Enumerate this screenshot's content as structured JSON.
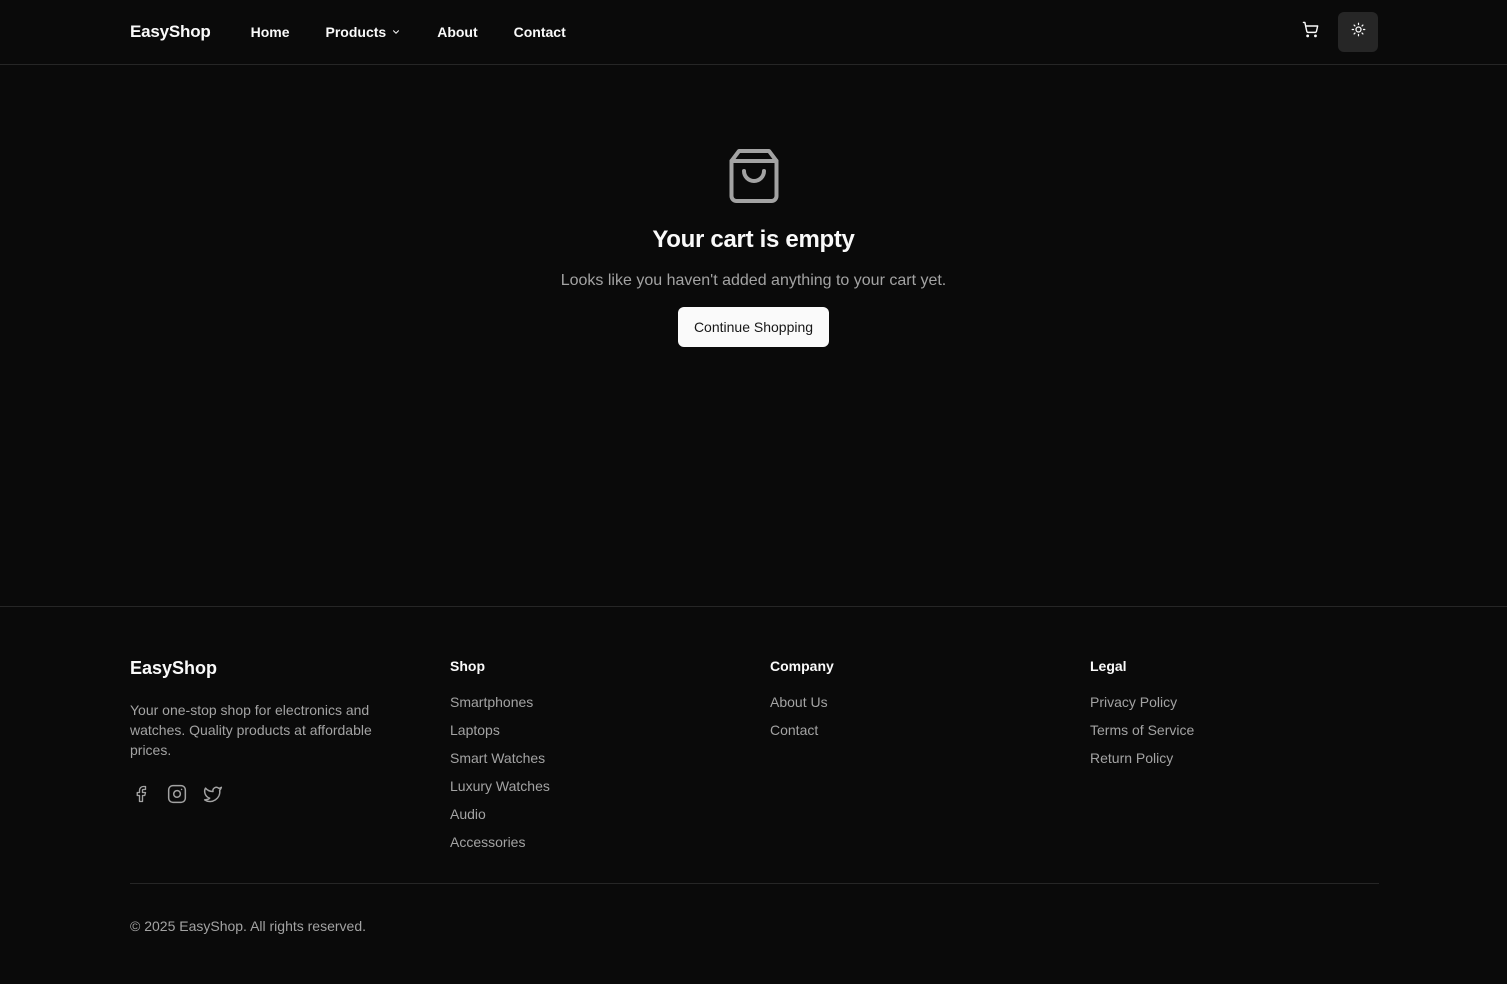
{
  "header": {
    "brand": "EasyShop",
    "nav": {
      "home": "Home",
      "products": "Products",
      "about": "About",
      "contact": "Contact"
    },
    "icons": {
      "cart": "shopping-cart-icon",
      "theme": "sun-icon",
      "dropdown": "chevron-down-icon"
    }
  },
  "empty_cart": {
    "icon": "shopping-bag-icon",
    "title": "Your cart is empty",
    "message": "Looks like you haven't added anything to your cart yet.",
    "button": "Continue Shopping"
  },
  "footer": {
    "brand": "EasyShop",
    "tagline": "Your one-stop shop for electronics and watches. Quality products at affordable prices.",
    "socials": [
      "facebook-icon",
      "instagram-icon",
      "twitter-icon"
    ],
    "shop": {
      "heading": "Shop",
      "links": [
        "Smartphones",
        "Laptops",
        "Smart Watches",
        "Luxury Watches",
        "Audio",
        "Accessories"
      ]
    },
    "company": {
      "heading": "Company",
      "links": [
        "About Us",
        "Contact"
      ]
    },
    "legal": {
      "heading": "Legal",
      "links": [
        "Privacy Policy",
        "Terms of Service",
        "Return Policy"
      ]
    },
    "copyright": "© 2025 EasyShop. All rights reserved."
  },
  "colors": {
    "background": "#0a0a0a",
    "foreground": "#fafafa",
    "muted": "#a3a3a3",
    "border": "#262626",
    "button_bg": "#fafafa",
    "button_text": "#171717"
  }
}
